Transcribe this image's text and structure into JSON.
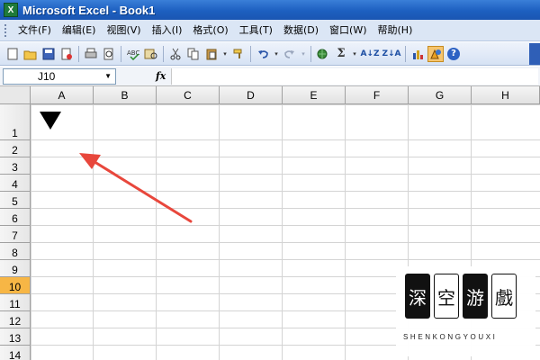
{
  "window": {
    "app_icon": "X",
    "title": "Microsoft Excel - Book1"
  },
  "menubar": {
    "items": [
      "文件(F)",
      "编辑(E)",
      "视图(V)",
      "插入(I)",
      "格式(O)",
      "工具(T)",
      "数据(D)",
      "窗口(W)",
      "帮助(H)"
    ]
  },
  "toolbar": {
    "icons": [
      "new-icon",
      "open-icon",
      "save-icon",
      "permission-icon",
      "print-icon",
      "print-preview-icon",
      "spelling-icon",
      "research-icon",
      "cut-icon",
      "copy-icon",
      "paste-icon",
      "format-painter-icon",
      "undo-icon",
      "redo-icon",
      "hyperlink-icon",
      "autosum-icon",
      "sort-ascending-icon",
      "sort-descending-icon",
      "chart-wizard-icon",
      "drawing-icon",
      "help-icon"
    ],
    "sigma": "Σ",
    "sort_asc": "A↓Z",
    "sort_desc": "Z↓A",
    "help": "?"
  },
  "formula_bar": {
    "name_box": "J10",
    "fx": "fx",
    "formula": ""
  },
  "sheet": {
    "columns": [
      "A",
      "B",
      "C",
      "D",
      "E",
      "F",
      "G",
      "H"
    ],
    "rows": [
      "1",
      "2",
      "3",
      "4",
      "5",
      "6",
      "7",
      "8",
      "9",
      "10",
      "11",
      "12",
      "13",
      "14"
    ],
    "selected_row": "10"
  },
  "colors": {
    "selected_header": "#f7b645",
    "arrow": "#e8473c"
  },
  "watermark": {
    "chars": [
      "深",
      "空",
      "游",
      "戲"
    ],
    "subtitle": "SHENKONGYOUXI"
  }
}
